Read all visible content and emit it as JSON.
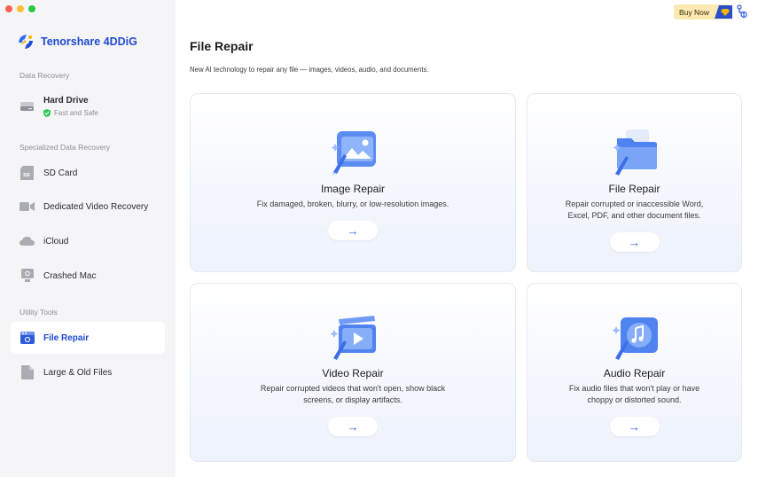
{
  "app": {
    "name": "Tenorshare 4DDiG"
  },
  "sidebar": {
    "sections": {
      "data_recovery": "Data Recovery",
      "specialized": "Specialized Data Recovery",
      "utility": "Utility Tools"
    },
    "hard_drive": {
      "label": "Hard Drive",
      "status": "Fast and Safe"
    },
    "items": [
      {
        "label": "SD Card",
        "icon": "sd-card-icon"
      },
      {
        "label": "Dedicated Video Recovery",
        "icon": "video-camera-icon"
      },
      {
        "label": "iCloud",
        "icon": "icloud-icon"
      },
      {
        "label": "Crashed Mac",
        "icon": "crashed-mac-icon"
      },
      {
        "label": "File Repair",
        "icon": "file-repair-icon",
        "active": true
      },
      {
        "label": "Large & Old Files",
        "icon": "file-icon"
      }
    ]
  },
  "header": {
    "buy_now": "Buy Now"
  },
  "main": {
    "title": "File Repair",
    "subtitle": "New AI technology to repair any file — images, videos, audio, and documents.",
    "cards": [
      {
        "title": "Image Repair",
        "desc1": "Fix damaged, broken, blurry, or low-resolution images.",
        "desc2": "",
        "arrow": "→"
      },
      {
        "title": "File Repair",
        "desc1": "Repair corrupted or inaccessible Word,",
        "desc2": "Excel, PDF, and other document files.",
        "arrow": "→"
      },
      {
        "title": "Video Repair",
        "desc1": "Repair corrupted videos that won't open, show black",
        "desc2": "screens, or display artifacts.",
        "arrow": "→"
      },
      {
        "title": "Audio Repair",
        "desc1": "Fix audio files that won't play or have",
        "desc2": "choppy or distorted sound.",
        "arrow": "→"
      }
    ]
  },
  "colors": {
    "accent": "#1e4bd1",
    "active_bg": "#ffffff",
    "sidebar_bg": "#f5f5f7",
    "buy_bg": "#fbe8b3"
  }
}
